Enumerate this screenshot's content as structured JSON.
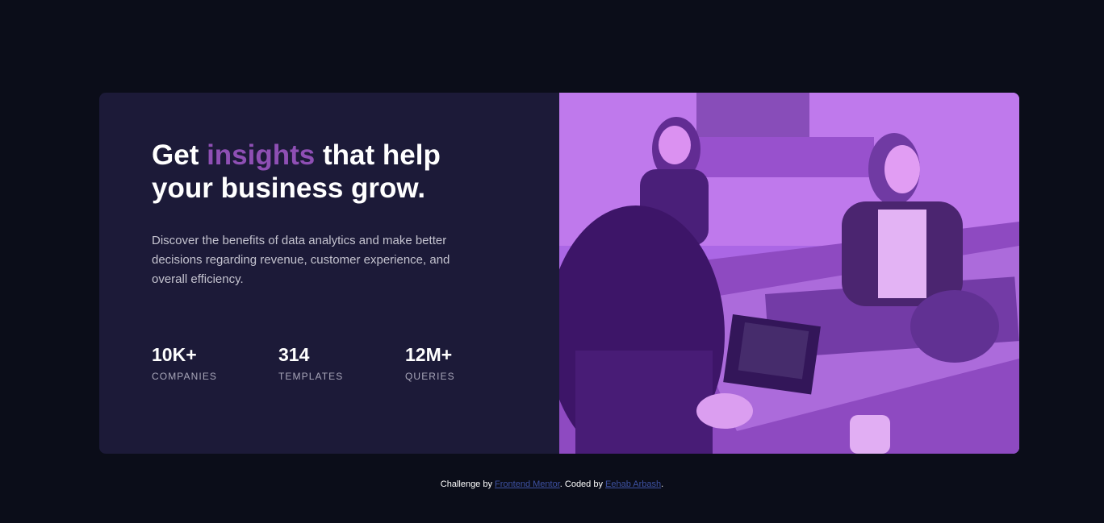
{
  "hero": {
    "headline_before": "Get ",
    "headline_accent": "insights",
    "headline_after": " that help your business grow.",
    "description": "Discover the benefits of data analytics and make better decisions regarding revenue, customer experience, and overall efficiency.",
    "accent_color": "#8e4fb4",
    "image": {
      "description_icon": "office-photo",
      "tint_color": "#a86ae0"
    }
  },
  "stats": [
    {
      "value": "10K+",
      "label": "COMPANIES"
    },
    {
      "value": "314",
      "label": "TEMPLATES"
    },
    {
      "value": "12M+",
      "label": "QUERIES"
    }
  ],
  "footer": {
    "challenge_prefix": "Challenge by ",
    "challenge_link": "Frontend Mentor",
    "coded_prefix": ". Coded by ",
    "author_link": "Eehab Arbash",
    "suffix": ".",
    "link_color": "#3e52a3"
  },
  "colors": {
    "page_background": "#0b0d19",
    "card_background": "#1c1a38"
  }
}
